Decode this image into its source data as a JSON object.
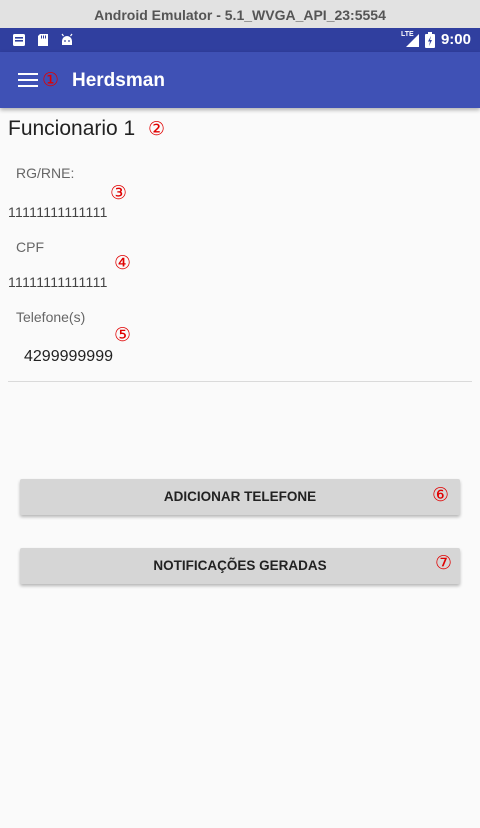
{
  "window": {
    "title": "Android Emulator - 5.1_WVGA_API_23:5554"
  },
  "status_bar": {
    "time": "9:00",
    "network_label": "LTE",
    "icons": [
      "notification-icon",
      "sd-card-icon",
      "android-icon",
      "lte-signal-icon",
      "battery-icon"
    ]
  },
  "app_bar": {
    "title": "Herdsman",
    "menu_icon": "hamburger-menu-icon"
  },
  "markers": {
    "m1": "①",
    "m2": "②",
    "m3": "③",
    "m4": "④",
    "m5": "⑤",
    "m6": "⑥",
    "m7": "⑦"
  },
  "employee": {
    "name": "Funcionario 1",
    "rg_label": "RG/RNE:",
    "rg_value": "11111111111111",
    "cpf_label": "CPF",
    "cpf_value": "11111111111111",
    "phones_label": "Telefone(s)",
    "phones": [
      "4299999999"
    ]
  },
  "buttons": {
    "add_phone": "ADICIONAR TELEFONE",
    "notifications": "NOTIFICAÇÕES GERADAS"
  },
  "colors": {
    "status_bar": "#303f9f",
    "app_bar": "#3f51b5",
    "marker": "#e00000",
    "button": "#d6d6d6"
  }
}
